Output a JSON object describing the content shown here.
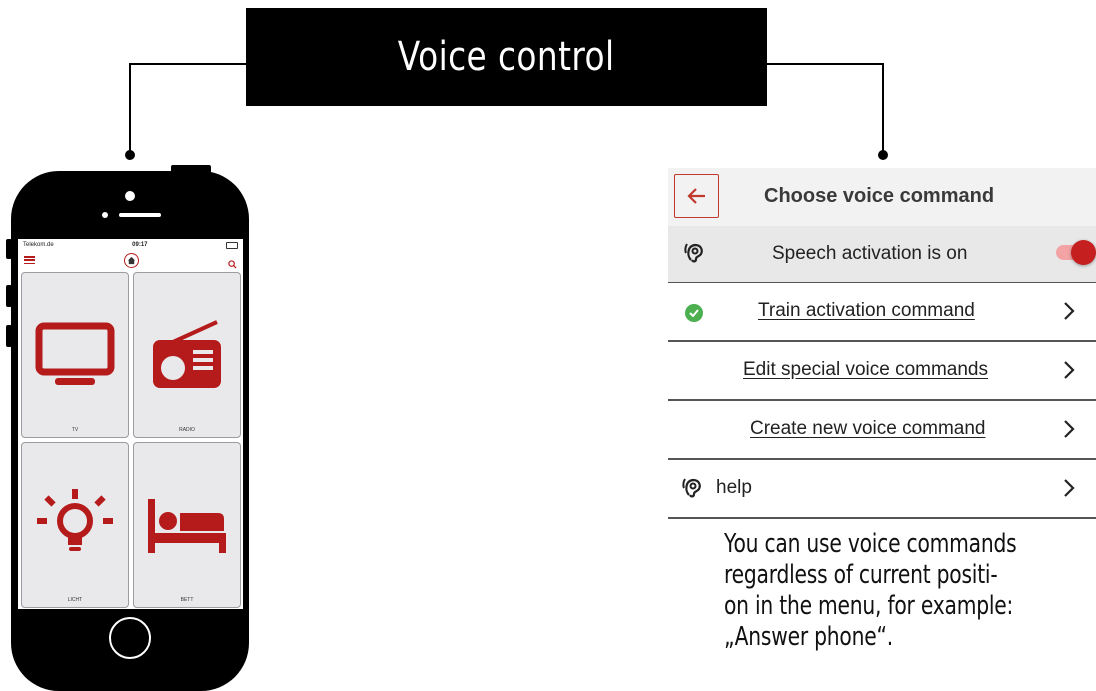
{
  "banner": {
    "title": "Voice control"
  },
  "phone": {
    "status": {
      "carrier": "Telekom.de",
      "time": "09:17"
    },
    "tiles": [
      {
        "label": "TV",
        "icon": "tv-icon"
      },
      {
        "label": "RADIO",
        "icon": "radio-icon"
      },
      {
        "label": "LICHT",
        "icon": "lightbulb-icon"
      },
      {
        "label": "BETT",
        "icon": "bed-icon"
      }
    ]
  },
  "panel": {
    "title": "Choose voice command",
    "speech_activation": {
      "label": "Speech activation is on",
      "enabled": true
    },
    "items": [
      {
        "label": "Train activation command",
        "status": "trained"
      },
      {
        "label": "Edit special voice commands"
      },
      {
        "label": "Create new voice command"
      }
    ],
    "help_label": "help"
  },
  "note": {
    "lines": [
      "You can use voice commands",
      "regardless of current positi-",
      "on in the menu, for example:",
      "„Answer phone“."
    ]
  },
  "colors": {
    "accent": "#b51b1b",
    "check": "#4caf50"
  }
}
